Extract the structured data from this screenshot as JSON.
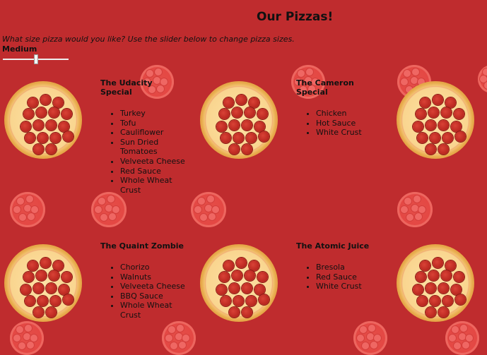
{
  "header": {
    "title": "Our Pizzas!"
  },
  "controls": {
    "question": "What size pizza would you like? Use the slider below to change pizza sizes.",
    "size_label": "Medium",
    "slider_value": 0.5
  },
  "pizzas": [
    {
      "name": "The Udacity Special",
      "ingredients": [
        "Turkey",
        "Tofu",
        "Cauliflower",
        "Sun Dried Tomatoes",
        "Velveeta Cheese",
        "Red Sauce",
        "Whole Wheat Crust"
      ]
    },
    {
      "name": "The Cameron Special",
      "ingredients": [
        "Chicken",
        "Hot Sauce",
        "White Crust"
      ]
    },
    {
      "name": "The Quaint Zombie",
      "ingredients": [
        "Chorizo",
        "Walnuts",
        "Velveeta Cheese",
        "BBQ Sauce",
        "Whole Wheat Crust"
      ]
    },
    {
      "name": "The Atomic Juice",
      "ingredients": [
        "Bresola",
        "Red Sauce",
        "White Crust"
      ]
    }
  ],
  "colors": {
    "background": "#bf2c2e",
    "accent": "#e64a46"
  },
  "icons": {
    "pizza": "pizza-icon",
    "background_pizza": "background-pizza-icon"
  }
}
